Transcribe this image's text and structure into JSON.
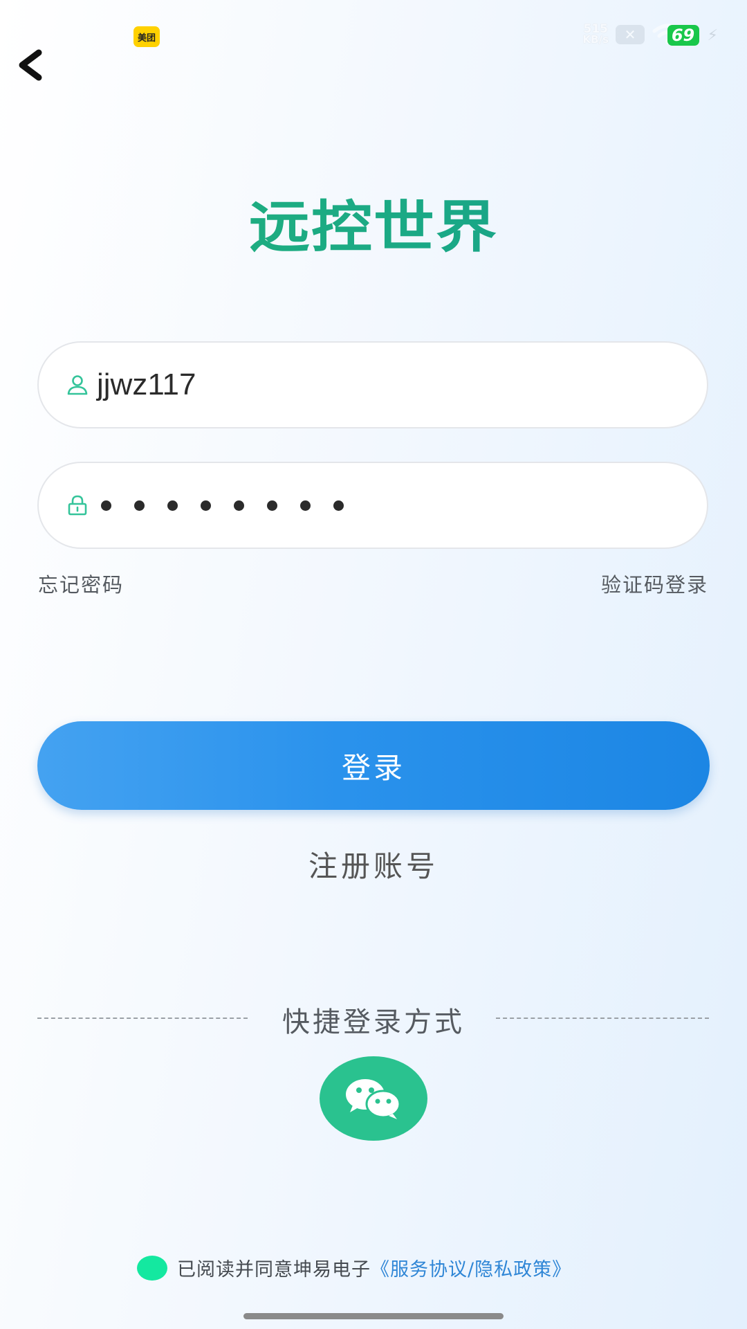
{
  "status_bar": {
    "app_notification_badge": "美团",
    "net_speed_value": "515",
    "net_speed_unit": "KB/s",
    "battery_level": "69",
    "icons": [
      "meituan-app-icon",
      "x-icon",
      "wifi-icon",
      "battery-icon",
      "charging-bolt-icon"
    ]
  },
  "nav": {
    "back_icon": "chevron-left-icon"
  },
  "header": {
    "app_title": "远控世界"
  },
  "login_form": {
    "username_value": "jjwz117",
    "username_icon": "user-icon",
    "password_icon": "lock-icon",
    "password_length": 8,
    "forgot_password_label": "忘记密码",
    "sms_login_label": "验证码登录",
    "login_button_label": "登录",
    "register_label": "注册账号"
  },
  "quick_login": {
    "label": "快捷登录方式",
    "wechat_icon": "wechat-icon"
  },
  "agreement": {
    "prefix_text": "已阅读并同意坤易电子",
    "link_text": "《服务协议/隐私政策》"
  },
  "colors": {
    "title_green": "#22b27a",
    "login_button_blue": "#2a92ec",
    "wechat_green": "#2ac28f",
    "agree_radio_green": "#14e8a0",
    "link_blue": "#2f86d6"
  }
}
